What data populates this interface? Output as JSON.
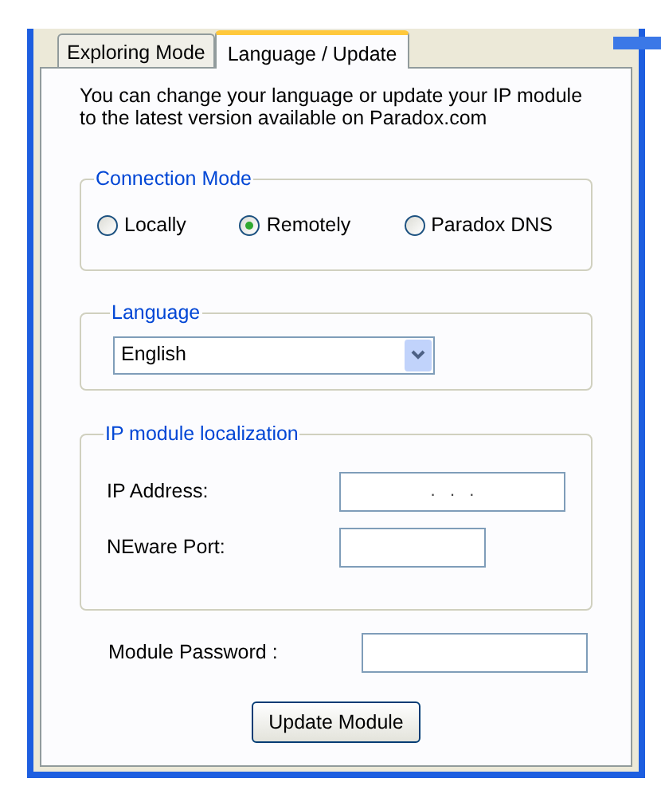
{
  "tabs": [
    {
      "label": "Exploring Mode",
      "selected": false
    },
    {
      "label": "Language / Update",
      "selected": true
    }
  ],
  "description": "You can change your language or update your IP module to the latest version available on Paradox.com",
  "connection_mode": {
    "title": "Connection Mode",
    "options": [
      {
        "label": "Locally",
        "selected": false
      },
      {
        "label": "Remotely",
        "selected": true
      },
      {
        "label": "Paradox DNS",
        "selected": false
      }
    ]
  },
  "language": {
    "title": "Language",
    "value": "English"
  },
  "ip_module_localization": {
    "title": "IP module localization",
    "fields": [
      {
        "label": "IP Address:",
        "kind": "ip",
        "value": ".   .   ."
      },
      {
        "label": "NEware Port:",
        "kind": "port"
      }
    ]
  },
  "module_password": {
    "label": "Module Password :"
  },
  "button": "Update Module"
}
